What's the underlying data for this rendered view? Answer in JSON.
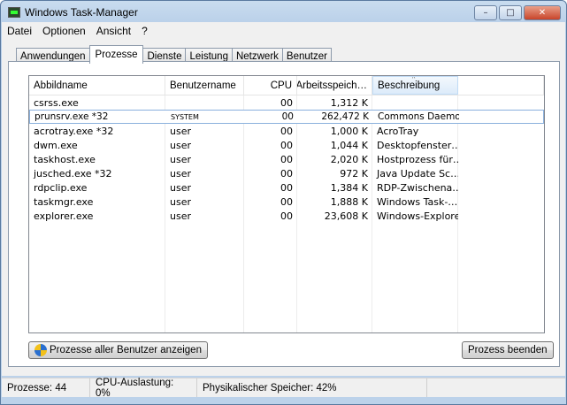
{
  "window": {
    "title": "Windows Task-Manager",
    "minimize": "–",
    "maximize": "□",
    "close": "✕"
  },
  "menu": [
    "Datei",
    "Optionen",
    "Ansicht",
    "?"
  ],
  "tabs": [
    "Anwendungen",
    "Prozesse",
    "Dienste",
    "Leistung",
    "Netzwerk",
    "Benutzer"
  ],
  "active_tab": "Prozesse",
  "columns": [
    "Abbildname",
    "Benutzername",
    "CPU",
    "Arbeitsspeich…",
    "Beschreibung"
  ],
  "sort_indicator": "^",
  "rows": [
    [
      "csrss.exe",
      "",
      "00",
      "1,312 K",
      ""
    ],
    [
      "prunsrv.exe *32",
      "SYSTEM",
      "00",
      "262,472 K",
      "Commons Daemon …"
    ],
    [
      "acrotray.exe *32",
      "user",
      "00",
      "1,000 K",
      "AcroTray"
    ],
    [
      "dwm.exe",
      "user",
      "00",
      "1,044 K",
      "Desktopfenster…"
    ],
    [
      "taskhost.exe",
      "user",
      "00",
      "2,020 K",
      "Hostprozess für…"
    ],
    [
      "jusched.exe *32",
      "user",
      "00",
      "972 K",
      "Java Update Sc…"
    ],
    [
      "rdpclip.exe",
      "user",
      "00",
      "1,384 K",
      "RDP-Zwischena…"
    ],
    [
      "taskmgr.exe",
      "user",
      "00",
      "1,888 K",
      "Windows Task-…"
    ],
    [
      "explorer.exe",
      "user",
      "00",
      "23,608 K",
      "Windows-Explorer"
    ]
  ],
  "buttons": {
    "show_all": "Prozesse aller Benutzer anzeigen",
    "end_process": "Prozess beenden"
  },
  "status": {
    "processes": "Prozesse: 44",
    "cpu": "CPU-Auslastung: 0%",
    "memory": "Physikalischer Speicher: 42%"
  }
}
